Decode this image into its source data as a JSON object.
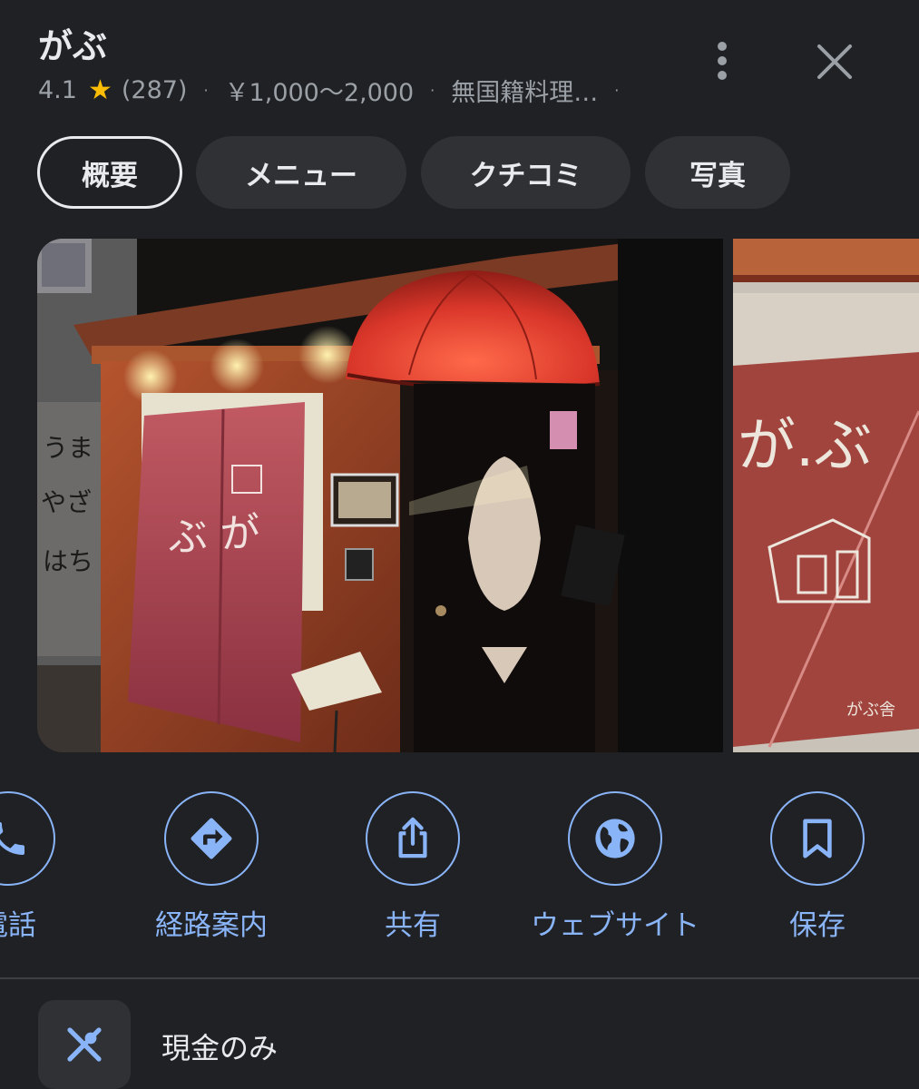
{
  "header": {
    "title": "がぶ",
    "rating": "4.1",
    "review_count": "(287)",
    "price_range": "￥1,000〜2,000",
    "category": "無国籍料理…",
    "separator": "·"
  },
  "tabs": [
    {
      "label": "概要",
      "active": true
    },
    {
      "label": "メニュー",
      "active": false
    },
    {
      "label": "クチコミ",
      "active": false
    },
    {
      "label": "写真",
      "active": false
    }
  ],
  "actions": [
    {
      "label": "電話",
      "icon": "phone-icon"
    },
    {
      "label": "経路案内",
      "icon": "directions-icon"
    },
    {
      "label": "共有",
      "icon": "share-icon"
    },
    {
      "label": "ウェブサイト",
      "icon": "globe-icon"
    },
    {
      "label": "保存",
      "icon": "bookmark-icon"
    }
  ],
  "info": {
    "payment": "現金のみ",
    "icon": "restaurant-icon"
  },
  "colors": {
    "background": "#202124",
    "accent": "#8ab4f8",
    "star": "#fbbc04",
    "chip": "#303134"
  }
}
